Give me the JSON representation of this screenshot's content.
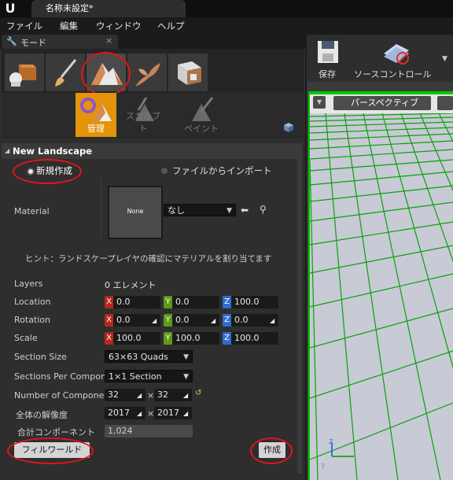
{
  "window": {
    "tab_title": "名称未設定*"
  },
  "menu": {
    "items": [
      "ファイル",
      "編集",
      "ウィンドウ",
      "ヘルプ"
    ]
  },
  "mode_panel": {
    "tab_label": "モード",
    "tools": [
      {
        "label": "管理",
        "active": true
      },
      {
        "label": "スカルプト",
        "active": false
      },
      {
        "label": "ペイント",
        "active": false
      }
    ]
  },
  "landscape": {
    "section_title": "New Landscape",
    "radio_new": "新規作成",
    "radio_import": "ファイルからインポート",
    "material_label": "Material",
    "material_thumb": "None",
    "material_value": "なし",
    "hint": "ヒント：ランドスケープレイヤの確認にマテリアルを割り当てます",
    "layers_label": "Layers",
    "layers_value": "0 エレメント",
    "location_label": "Location",
    "location": {
      "x": "0.0",
      "y": "0.0",
      "z": "100.0"
    },
    "rotation_label": "Rotation",
    "rotation": {
      "x": "0.0",
      "y": "0.0",
      "z": "0.0"
    },
    "scale_label": "Scale",
    "scale": {
      "x": "100.0",
      "y": "100.0",
      "z": "100.0"
    },
    "section_size_label": "Section Size",
    "section_size_value": "63×63 Quads",
    "sections_per_component_label": "Sections Per Compon",
    "sections_per_component_value": "1×1 Section",
    "num_components_label": "Number of Componen",
    "num_components": {
      "x": "32",
      "y": "32"
    },
    "resolution_label": "全体の解像度",
    "resolution": {
      "x": "2017",
      "y": "2017"
    },
    "total_components_label": "合計コンポーネント",
    "total_components_value": "1,024",
    "times_symbol": "×",
    "fill_world_button": "フィルワールド",
    "create_button": "作成"
  },
  "right_toolbar": {
    "save_label": "保存",
    "source_control_label": "ソースコントロール"
  },
  "viewport": {
    "perspective_label": "パースペクティブ"
  }
}
